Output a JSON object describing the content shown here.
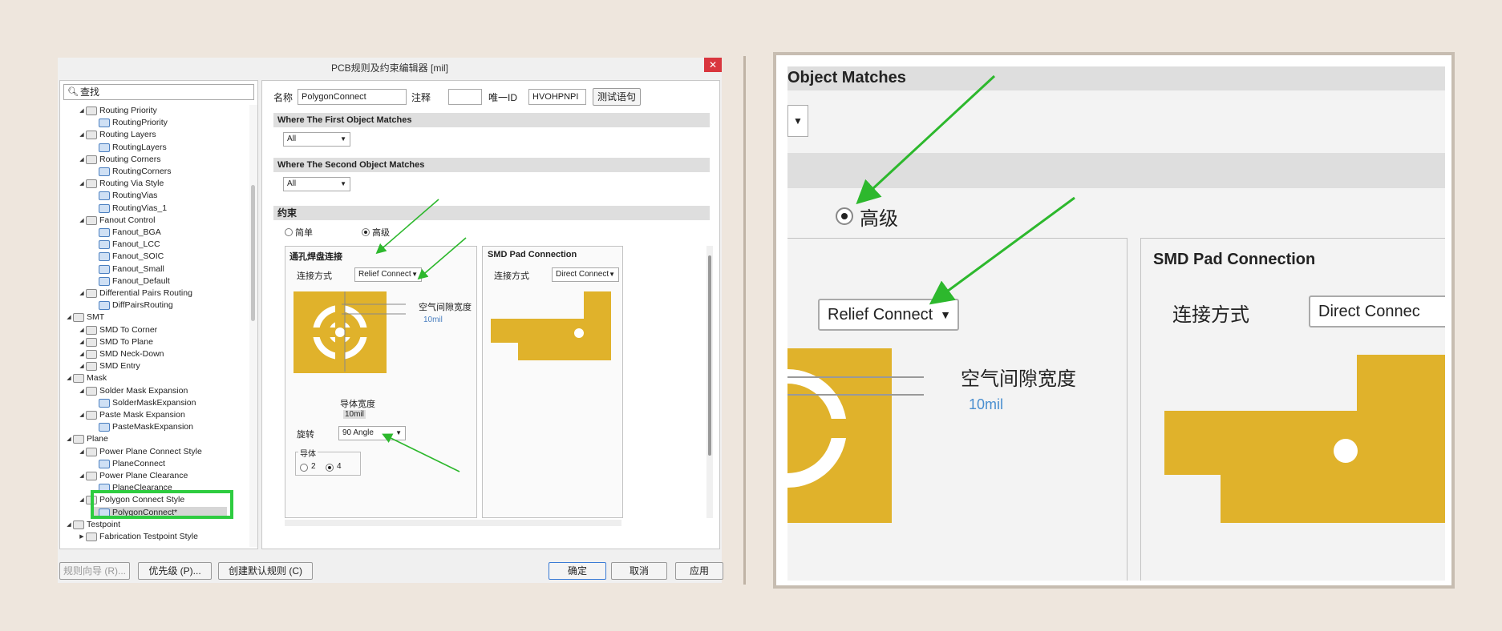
{
  "dialog": {
    "title": "PCB规则及约束编辑器 [mil]",
    "close_icon": "close-icon",
    "search_placeholder": "查找",
    "tree": [
      {
        "label": "Routing Priority",
        "level": 2,
        "expanded": true
      },
      {
        "label": "RoutingPriority",
        "level": 3
      },
      {
        "label": "Routing Layers",
        "level": 2,
        "expanded": true
      },
      {
        "label": "RoutingLayers",
        "level": 3
      },
      {
        "label": "Routing Corners",
        "level": 2,
        "expanded": true
      },
      {
        "label": "RoutingCorners",
        "level": 3
      },
      {
        "label": "Routing Via Style",
        "level": 2,
        "expanded": true
      },
      {
        "label": "RoutingVias",
        "level": 3
      },
      {
        "label": "RoutingVias_1",
        "level": 3
      },
      {
        "label": "Fanout Control",
        "level": 2,
        "expanded": true
      },
      {
        "label": "Fanout_BGA",
        "level": 3
      },
      {
        "label": "Fanout_LCC",
        "level": 3
      },
      {
        "label": "Fanout_SOIC",
        "level": 3
      },
      {
        "label": "Fanout_Small",
        "level": 3
      },
      {
        "label": "Fanout_Default",
        "level": 3
      },
      {
        "label": "Differential Pairs Routing",
        "level": 2,
        "expanded": true
      },
      {
        "label": "DiffPairsRouting",
        "level": 3
      },
      {
        "label": "SMT",
        "level": 1,
        "expanded": true
      },
      {
        "label": "SMD To Corner",
        "level": 2
      },
      {
        "label": "SMD To Plane",
        "level": 2
      },
      {
        "label": "SMD Neck-Down",
        "level": 2
      },
      {
        "label": "SMD Entry",
        "level": 2
      },
      {
        "label": "Mask",
        "level": 1,
        "expanded": true
      },
      {
        "label": "Solder Mask Expansion",
        "level": 2,
        "expanded": true
      },
      {
        "label": "SolderMaskExpansion",
        "level": 3
      },
      {
        "label": "Paste Mask Expansion",
        "level": 2,
        "expanded": true
      },
      {
        "label": "PasteMaskExpansion",
        "level": 3
      },
      {
        "label": "Plane",
        "level": 1,
        "expanded": true
      },
      {
        "label": "Power Plane Connect Style",
        "level": 2,
        "expanded": true
      },
      {
        "label": "PlaneConnect",
        "level": 3
      },
      {
        "label": "Power Plane Clearance",
        "level": 2,
        "expanded": true
      },
      {
        "label": "PlaneClearance",
        "level": 3
      },
      {
        "label": "Polygon Connect Style",
        "level": 2,
        "expanded": true
      },
      {
        "label": "PolygonConnect*",
        "level": 3,
        "selected": true
      },
      {
        "label": "Testpoint",
        "level": 1,
        "expanded": true
      },
      {
        "label": "Fabrication Testpoint Style",
        "level": 2,
        "expanded": false
      }
    ],
    "form": {
      "name_label": "名称",
      "name_value": "PolygonConnect",
      "comment_label": "注释",
      "comment_value": "",
      "id_label": "唯一ID",
      "id_value": "HVOHPNPI",
      "test_button": "测试语句",
      "first_match_header": "Where The First Object Matches",
      "first_match_value": "All",
      "second_match_header": "Where The Second Object Matches",
      "second_match_value": "All",
      "constraints_header": "约束",
      "radio_simple": "简单",
      "radio_advanced": "高级",
      "thru_title": "通孔焊盘连接",
      "connect_label": "连接方式",
      "thru_connect_value": "Relief Connect",
      "air_gap_label": "空气间隙宽度",
      "air_gap_value": "10mil",
      "conductor_width_label": "导体宽度",
      "conductor_width_value": "10mil",
      "rotation_label": "旋转",
      "rotation_value": "90 Angle",
      "conductors_label": "导体",
      "conductors_opt1": "2",
      "conductors_opt2": "4",
      "smd_title": "SMD Pad Connection",
      "smd_connect_value": "Direct Connect"
    },
    "buttons": {
      "wizard": "规则向导 (R)...",
      "priority": "优先级 (P)...",
      "create_default": "创建默认规则 (C)",
      "ok": "确定",
      "cancel": "取消",
      "apply": "应用"
    }
  },
  "zoom": {
    "header": "Object Matches",
    "radio_advanced": "高级",
    "connect_value": "Relief Connect",
    "air_gap_label": "空气间隙宽度",
    "air_gap_value": "10mil",
    "smd_title": "SMD Pad Connection",
    "connect_label": "连接方式",
    "smd_connect_value": "Direct Connec"
  },
  "colors": {
    "pad": "#e0b22b",
    "highlight": "#2ecc40",
    "arrow": "#2db82d"
  }
}
